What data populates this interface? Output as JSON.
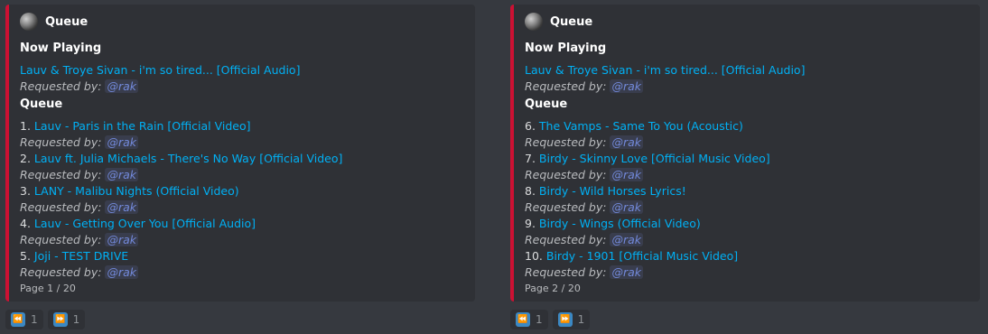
{
  "embeds": [
    {
      "author": "Queue",
      "now_playing_title": "Now Playing",
      "now_playing": {
        "song": "Lauv & Troye Sivan - i'm so tired... [Official Audio]",
        "requested_label": "Requested by:",
        "requester": "@rak"
      },
      "queue_title": "Queue",
      "queue": [
        {
          "num": "1.",
          "song": "Lauv - Paris in the Rain [Official Video]",
          "requested_label": "Requested by:",
          "requester": "@rak"
        },
        {
          "num": "2.",
          "song": "Lauv ft. Julia Michaels - There's No Way [Official Video]",
          "requested_label": "Requested by:",
          "requester": "@rak"
        },
        {
          "num": "3.",
          "song": "LANY - Malibu Nights (Official Video)",
          "requested_label": "Requested by:",
          "requester": "@rak"
        },
        {
          "num": "4.",
          "song": "Lauv - Getting Over You [Official Audio]",
          "requested_label": "Requested by:",
          "requester": "@rak"
        },
        {
          "num": "5.",
          "song": "Joji - TEST DRIVE",
          "requested_label": "Requested by:",
          "requester": "@rak"
        }
      ],
      "footer": "Page 1 / 20",
      "reactions": [
        {
          "icon": "rewind-icon",
          "glyph": "⏪",
          "count": "1"
        },
        {
          "icon": "fast-forward-icon",
          "glyph": "⏩",
          "count": "1"
        }
      ]
    },
    {
      "author": "Queue",
      "now_playing_title": "Now Playing",
      "now_playing": {
        "song": "Lauv & Troye Sivan - i'm so tired... [Official Audio]",
        "requested_label": "Requested by:",
        "requester": "@rak"
      },
      "queue_title": "Queue",
      "queue": [
        {
          "num": "6.",
          "song": "The Vamps - Same To You (Acoustic)",
          "requested_label": "Requested by:",
          "requester": "@rak"
        },
        {
          "num": "7.",
          "song": "Birdy - Skinny Love [Official Music Video]",
          "requested_label": "Requested by:",
          "requester": "@rak"
        },
        {
          "num": "8.",
          "song": "Birdy - Wild Horses Lyrics!",
          "requested_label": "Requested by:",
          "requester": "@rak"
        },
        {
          "num": "9.",
          "song": "Birdy - Wings (Official Video)",
          "requested_label": "Requested by:",
          "requester": "@rak"
        },
        {
          "num": "10.",
          "song": "Birdy - 1901 [Official Music Video]",
          "requested_label": "Requested by:",
          "requester": "@rak"
        }
      ],
      "footer": "Page 2 / 20",
      "reactions": [
        {
          "icon": "rewind-icon",
          "glyph": "⏪",
          "count": "1"
        },
        {
          "icon": "fast-forward-icon",
          "glyph": "⏩",
          "count": "1"
        }
      ]
    }
  ],
  "colors": {
    "embed_border": "#cc1133",
    "link": "#00b0f4",
    "mention": "#7289da",
    "reaction_emoji_bg": "#3b88c3"
  }
}
